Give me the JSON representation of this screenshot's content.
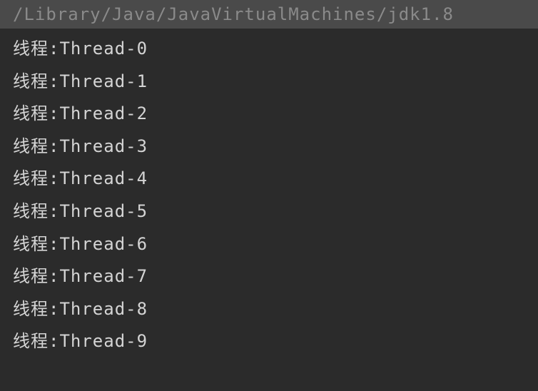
{
  "header": {
    "path": "/Library/Java/JavaVirtualMachines/jdk1.8"
  },
  "output": {
    "lines": [
      "线程:Thread-0",
      "线程:Thread-1",
      "线程:Thread-2",
      "线程:Thread-3",
      "线程:Thread-4",
      "线程:Thread-5",
      "线程:Thread-6",
      "线程:Thread-7",
      "线程:Thread-8",
      "线程:Thread-9"
    ]
  }
}
